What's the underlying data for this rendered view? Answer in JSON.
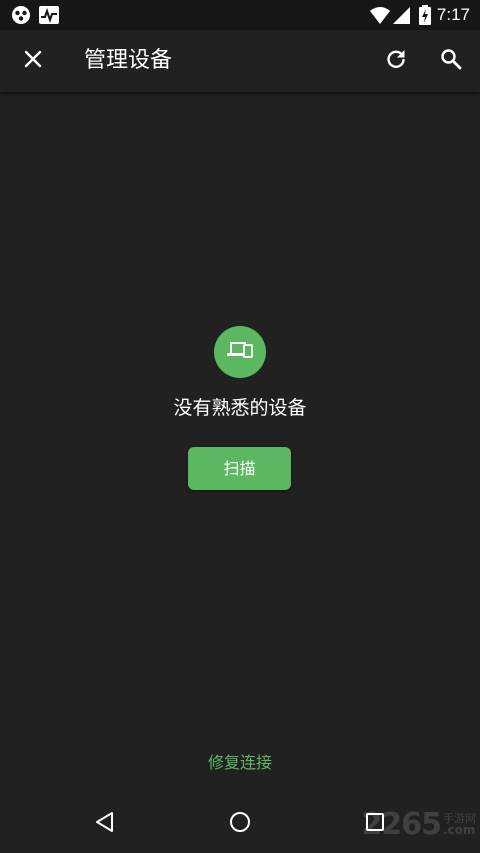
{
  "status_bar": {
    "time": "7:17",
    "icons": [
      "app-notification-icon",
      "activity-icon",
      "wifi-icon",
      "cell-signal-icon",
      "battery-charging-icon"
    ]
  },
  "toolbar": {
    "title": "管理设备",
    "close_icon": "close-icon",
    "refresh_icon": "refresh-icon",
    "search_icon": "search-icon"
  },
  "empty_state": {
    "icon": "devices-icon",
    "message": "没有熟悉的设备",
    "scan_button_label": "扫描"
  },
  "footer": {
    "fix_connection_label": "修复连接"
  },
  "nav_bar": {
    "back_icon": "back-triangle-icon",
    "home_icon": "home-circle-icon",
    "recents_icon": "recents-square-icon"
  },
  "watermark": {
    "number": "2265",
    "label_cn": "手游网",
    "label_com": ".com"
  },
  "colors": {
    "background": "#212121",
    "status_bar": "#171717",
    "accent_green": "#5cb860",
    "text_primary": "#ffffff"
  }
}
